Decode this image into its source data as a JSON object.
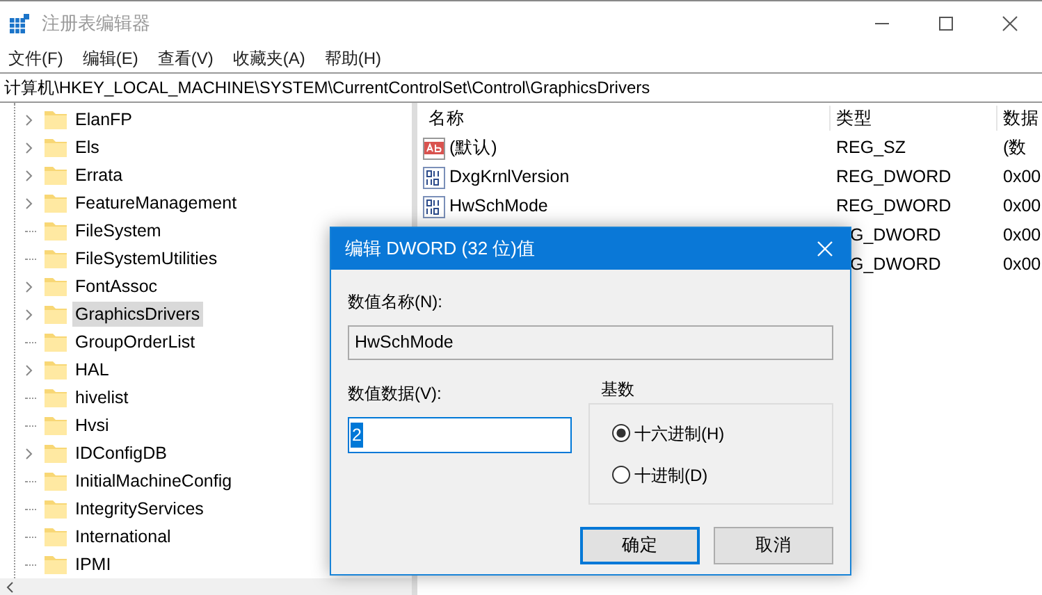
{
  "window": {
    "title": "注册表编辑器"
  },
  "menu": [
    "文件(F)",
    "编辑(E)",
    "查看(V)",
    "收藏夹(A)",
    "帮助(H)"
  ],
  "address": "计算机\\HKEY_LOCAL_MACHINE\\SYSTEM\\CurrentControlSet\\Control\\GraphicsDrivers",
  "tree": [
    {
      "label": "ElanFP",
      "expandable": true,
      "selected": false
    },
    {
      "label": "Els",
      "expandable": true,
      "selected": false
    },
    {
      "label": "Errata",
      "expandable": true,
      "selected": false
    },
    {
      "label": "FeatureManagement",
      "expandable": true,
      "selected": false
    },
    {
      "label": "FileSystem",
      "expandable": false,
      "selected": false
    },
    {
      "label": "FileSystemUtilities",
      "expandable": false,
      "selected": false
    },
    {
      "label": "FontAssoc",
      "expandable": true,
      "selected": false
    },
    {
      "label": "GraphicsDrivers",
      "expandable": true,
      "selected": true
    },
    {
      "label": "GroupOrderList",
      "expandable": false,
      "selected": false
    },
    {
      "label": "HAL",
      "expandable": true,
      "selected": false
    },
    {
      "label": "hivelist",
      "expandable": false,
      "selected": false
    },
    {
      "label": "Hvsi",
      "expandable": false,
      "selected": false
    },
    {
      "label": "IDConfigDB",
      "expandable": true,
      "selected": false
    },
    {
      "label": "InitialMachineConfig",
      "expandable": false,
      "selected": false
    },
    {
      "label": "IntegrityServices",
      "expandable": false,
      "selected": false
    },
    {
      "label": "International",
      "expandable": false,
      "selected": false
    },
    {
      "label": "IPMI",
      "expandable": false,
      "selected": false
    }
  ],
  "table": {
    "columns": [
      "名称",
      "类型",
      "数据"
    ],
    "rows": [
      {
        "kind": "string",
        "name": "(默认)",
        "type": "REG_SZ",
        "data": "(数"
      },
      {
        "kind": "binary",
        "name": "DxgKrnlVersion",
        "type": "REG_DWORD",
        "data": "0x00"
      },
      {
        "kind": "binary",
        "name": "HwSchMode",
        "type": "REG_DWORD",
        "data": "0x00"
      },
      {
        "kind": "covered",
        "type": "G_DWORD",
        "data": "0x00"
      },
      {
        "kind": "covered",
        "type": "G_DWORD",
        "data": "0x00"
      }
    ]
  },
  "dialog": {
    "title": "编辑 DWORD (32 位)值",
    "name_label": "数值名称(N):",
    "name_value": "HwSchMode",
    "data_label": "数值数据(V):",
    "data_value": "2",
    "base_label": "基数",
    "radios": [
      {
        "label": "十六进制(H)",
        "selected": true
      },
      {
        "label": "十进制(D)",
        "selected": false
      }
    ],
    "buttons": [
      {
        "label": "确定",
        "default": true
      },
      {
        "label": "取消",
        "default": false
      }
    ]
  }
}
